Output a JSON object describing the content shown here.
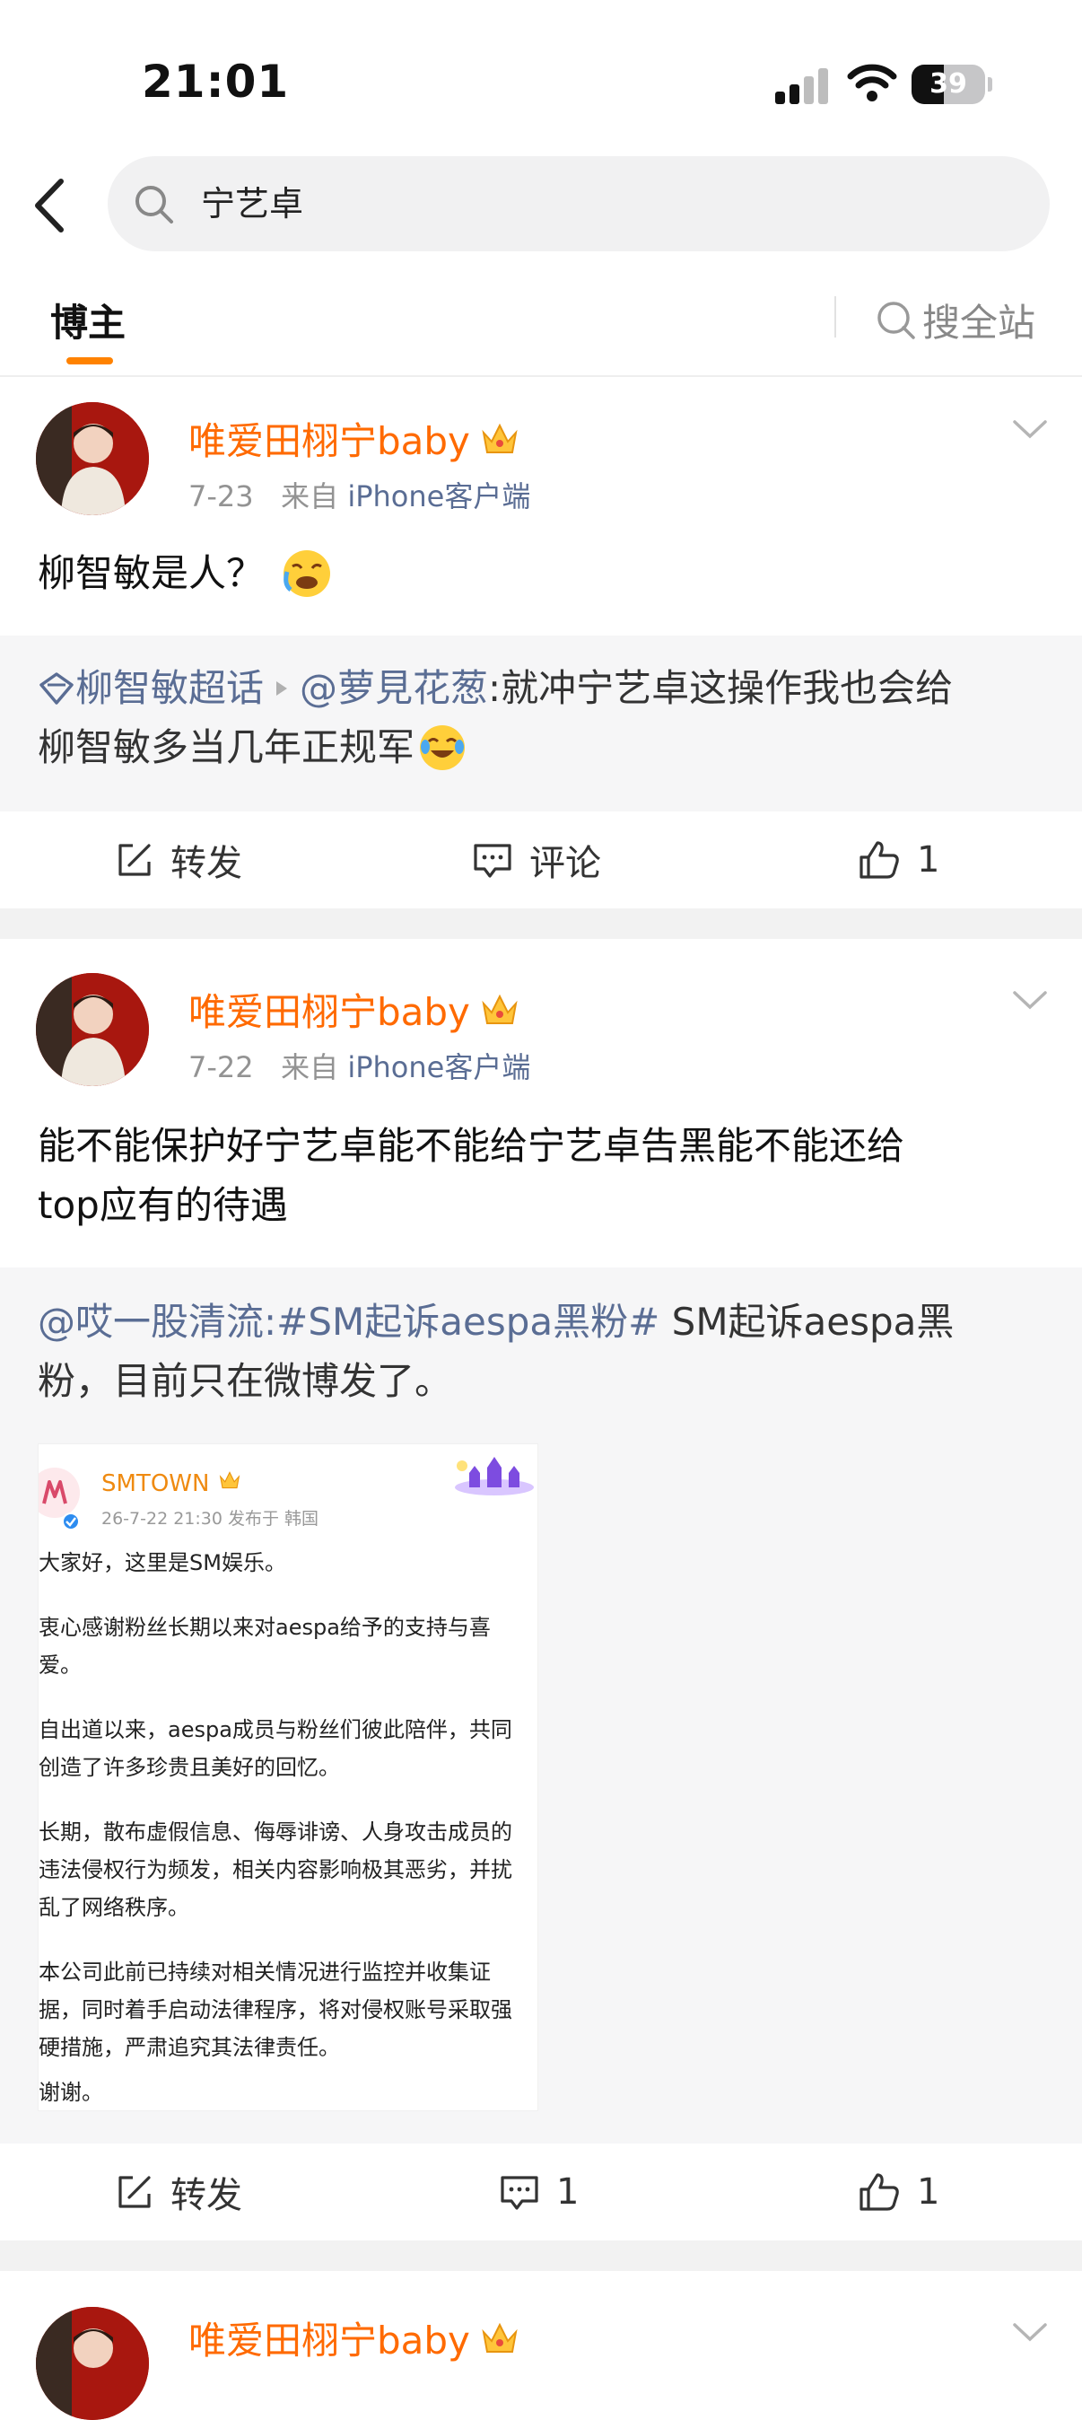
{
  "status_bar": {
    "time": "21:01",
    "battery": "39"
  },
  "search": {
    "query": "宁艺卓"
  },
  "tabs": {
    "bloggers": "博主",
    "site_search": "搜全站"
  },
  "posts": [
    {
      "user": "唯爱田栩宁baby",
      "date": "7-23",
      "source_prefix": "来自",
      "source": "iPhone客户端",
      "text": "柳智敏是人？",
      "repost": {
        "topic": "柳智敏超话",
        "mention": "@萝見花葱",
        "text": ":就冲宁艺卓这操作我也会给",
        "text2": "柳智敏多当几年正规军"
      },
      "actions": {
        "repost": "转发",
        "comment": "评论",
        "like": "1"
      }
    },
    {
      "user": "唯爱田栩宁baby",
      "date": "7-22",
      "source_prefix": "来自",
      "source": "iPhone客户端",
      "text": "能不能保护好宁艺卓能不能给宁艺卓告黑能不能还给",
      "text2": "top应有的待遇",
      "repost": {
        "mention": "@哎一股清流",
        "hashtag": ":#SM起诉aespa黑粉#",
        "text": " SM起诉aespa黑",
        "text2": "粉，目前只在微博发了。"
      },
      "embedded_image": {
        "account": "SMTOWN",
        "date": "26-7-22 21:30  发布于 韩国",
        "lines": [
          "大家好，这里是SM娱乐。",
          "衷心感谢粉丝长期以来对aespa给予的支持与喜",
          "爱。",
          "自出道以来，aespa成员与粉丝们彼此陪伴，共同",
          "创造了许多珍贵且美好的回忆。",
          "长期，散布虚假信息、侮辱诽谤、人身攻击成员的",
          "违法侵权行为频发，相关内容影响极其恶劣，并扰",
          "乱了网络秩序。",
          "本公司此前已持续对相关情况进行监控并收集证",
          "据，同时着手启动法律程序，将对侵权账号采取强",
          "硬措施，严肃追究其法律责任。",
          "谢谢。"
        ]
      },
      "actions": {
        "repost": "转发",
        "comment": "1",
        "like": "1"
      }
    },
    {
      "user": "唯爱田栩宁baby"
    }
  ],
  "colors": {
    "accent": "#ff8200",
    "username": "#ff6a00",
    "link": "#5a6d94"
  }
}
